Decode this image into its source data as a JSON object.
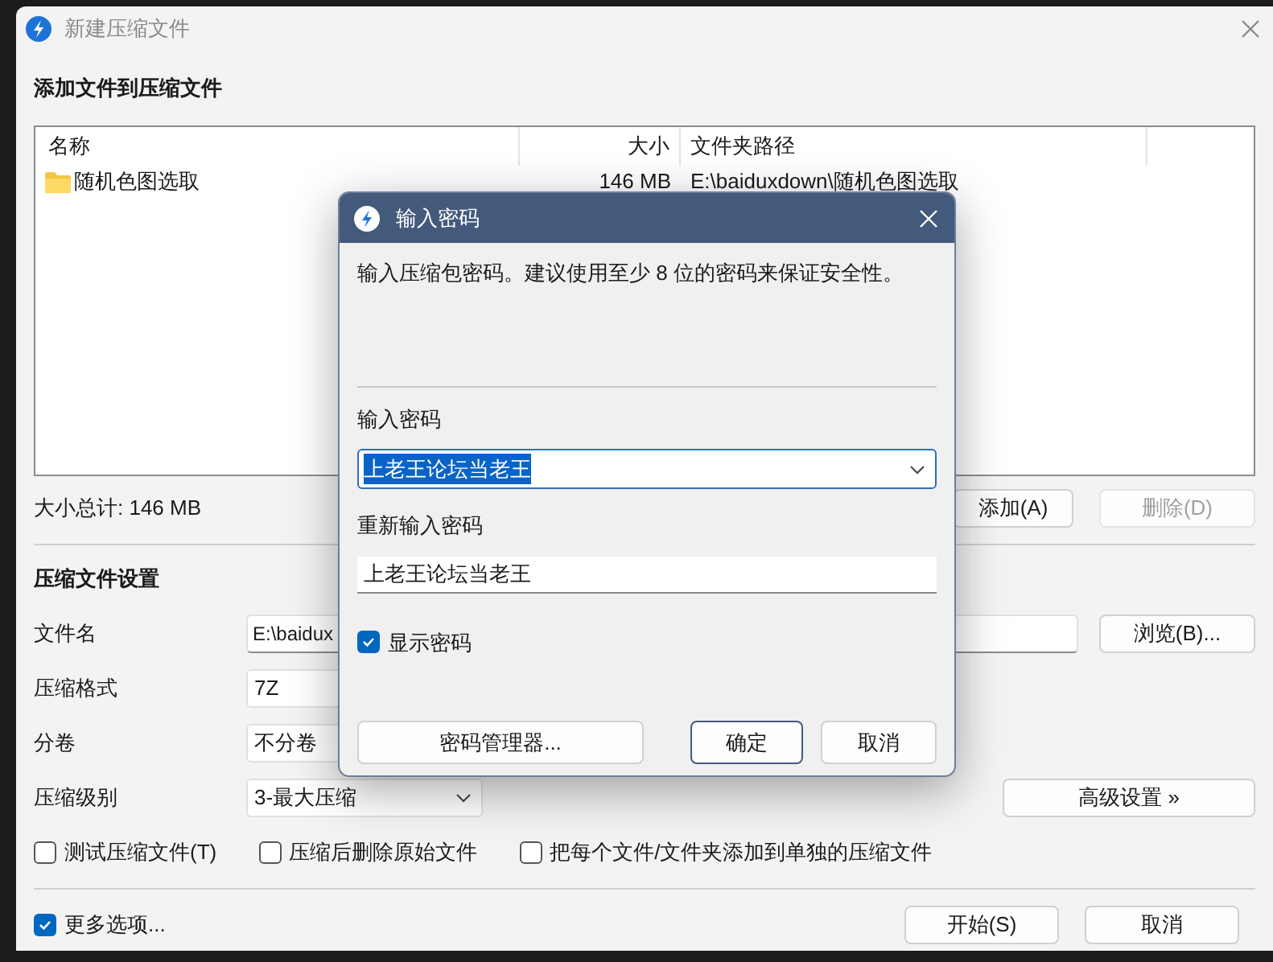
{
  "window": {
    "title": "新建压缩文件",
    "active": false
  },
  "files_section": {
    "heading": "添加文件到压缩文件",
    "columns": [
      "名称",
      "大小",
      "文件夹路径"
    ],
    "rows": [
      {
        "name": "随机色图选取",
        "size": "146 MB",
        "path": "E:\\baiduxdown\\随机色图选取"
      }
    ],
    "total": "大小总计: 146 MB",
    "buttons": [
      {
        "label": "添加(A)",
        "disabled": false
      },
      {
        "label": "删除(D)",
        "disabled": true
      }
    ]
  },
  "settings": {
    "heading": "压缩文件设置",
    "fields": [
      {
        "label": "文件名",
        "value": "E:\\baidux",
        "kind": "text"
      },
      {
        "label": "压缩格式",
        "value": "7Z",
        "kind": "box"
      },
      {
        "label": "分卷",
        "value": "不分卷",
        "kind": "box"
      },
      {
        "label": "压缩级别",
        "value": "3-最大压缩",
        "kind": "dropdown"
      }
    ],
    "browse_button": "浏览(B)...",
    "advanced_button": "高级设置 »",
    "options": [
      {
        "label": "测试压缩文件(T)",
        "checked": false
      },
      {
        "label": "压缩后删除原始文件",
        "checked": false
      },
      {
        "label": "把每个文件/文件夹添加到单独的压缩文件",
        "checked": false
      }
    ]
  },
  "footer": {
    "more_options": {
      "label": "更多选项...",
      "checked": true
    },
    "buttons": [
      "开始(S)",
      "取消"
    ]
  },
  "password_dialog": {
    "title": "输入密码",
    "description": "输入压缩包密码。建议使用至少 8 位的密码来保证安全性。",
    "password_label": "输入密码",
    "password": "上老王论坛当老王",
    "password_selected": true,
    "confirm_label": "重新输入密码",
    "confirm_password": "上老王论坛当老王",
    "show_password": {
      "label": "显示密码",
      "checked": true
    },
    "buttons": [
      {
        "label": "密码管理器...",
        "default": false
      },
      {
        "label": "确定",
        "default": true
      },
      {
        "label": "取消",
        "default": false
      }
    ]
  }
}
